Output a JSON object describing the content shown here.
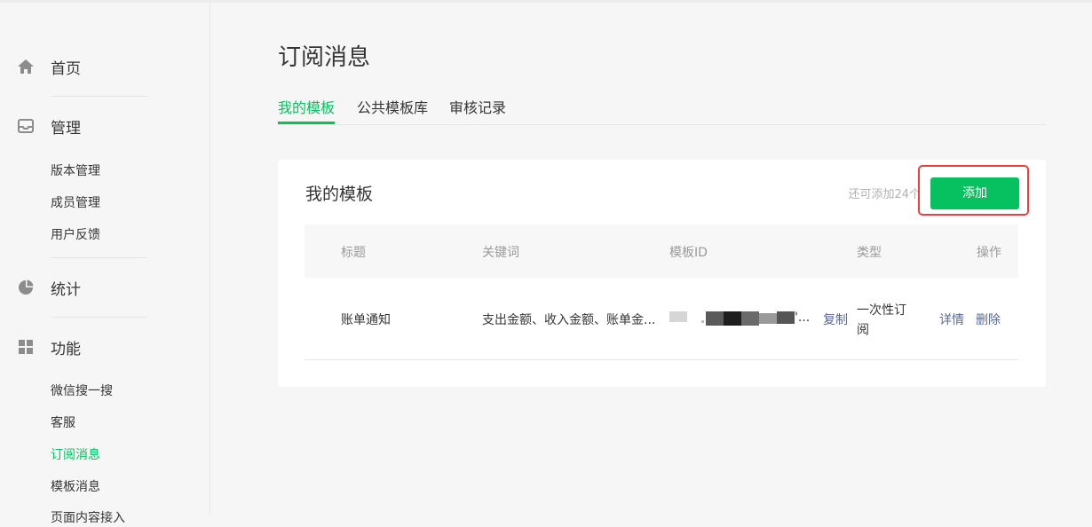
{
  "sidebar": {
    "home_label": "首页",
    "manage_label": "管理",
    "manage_items": [
      "版本管理",
      "成员管理",
      "用户反馈"
    ],
    "stats_label": "统计",
    "features_label": "功能",
    "feature_items": [
      "微信搜一搜",
      "客服",
      "订阅消息",
      "模板消息",
      "页面内容接入"
    ],
    "active_item": "订阅消息",
    "icons": [
      "home-icon",
      "inbox-icon",
      "pie-chart-icon",
      "grid-icon"
    ]
  },
  "page": {
    "title": "订阅消息",
    "tabs": [
      "我的模板",
      "公共模板库",
      "审核记录"
    ],
    "active_tab": "我的模板"
  },
  "card": {
    "title": "我的模板",
    "remaining": "还可添加24个",
    "add_button": "添加",
    "columns": [
      "标题",
      "关键词",
      "模板ID",
      "类型",
      "操作"
    ],
    "rows": [
      {
        "title": "账单通知",
        "keywords": "支出金额、收入金额、账单金...",
        "template_id_suffix": "'...",
        "copy": "复制",
        "type_line1": "一次性订",
        "type_line2": "阅",
        "detail": "详情",
        "delete": "删除"
      }
    ]
  },
  "colors": {
    "accent": "#07c160",
    "link": "#576b95",
    "highlight": "#e64340"
  }
}
